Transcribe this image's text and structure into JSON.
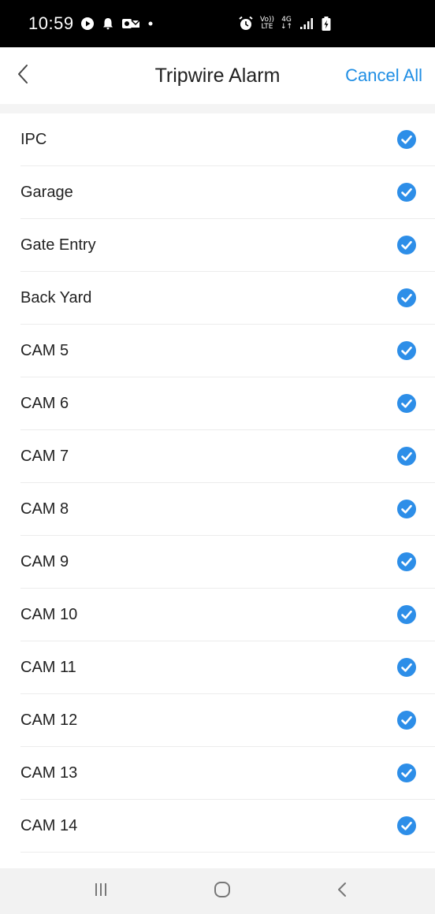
{
  "status_bar": {
    "time": "10:59",
    "volte_top": "Vo))",
    "volte_bottom": "LTE",
    "network_top": "4G",
    "network_bottom": "↓↑"
  },
  "header": {
    "title": "Tripwire Alarm",
    "action_label": "Cancel All"
  },
  "colors": {
    "accent": "#1f8ee4",
    "check": "#2d8ee8",
    "divider": "#ececec"
  },
  "cameras": [
    {
      "label": "IPC",
      "checked": true
    },
    {
      "label": "Garage",
      "checked": true
    },
    {
      "label": "Gate Entry",
      "checked": true
    },
    {
      "label": "Back Yard",
      "checked": true
    },
    {
      "label": "CAM 5",
      "checked": true
    },
    {
      "label": "CAM 6",
      "checked": true
    },
    {
      "label": "CAM 7",
      "checked": true
    },
    {
      "label": "CAM 8",
      "checked": true
    },
    {
      "label": "CAM 9",
      "checked": true
    },
    {
      "label": "CAM 10",
      "checked": true
    },
    {
      "label": "CAM 11",
      "checked": true
    },
    {
      "label": "CAM 12",
      "checked": true
    },
    {
      "label": "CAM 13",
      "checked": true
    },
    {
      "label": "CAM 14",
      "checked": true
    }
  ],
  "icons": {
    "back": "chevron-left-icon",
    "check": "check-circle-icon",
    "nav_recents": "recents-icon",
    "nav_home": "home-icon",
    "nav_back": "back-icon"
  }
}
